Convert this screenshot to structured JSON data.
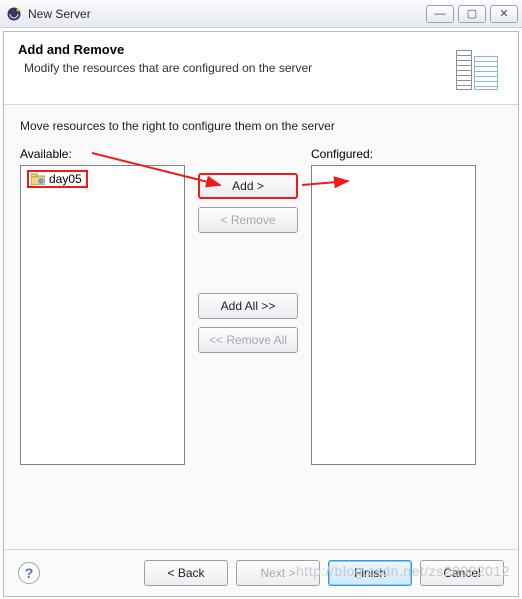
{
  "window": {
    "title": "New Server",
    "minimize_glyph": "—",
    "maximize_glyph": "▢",
    "close_glyph": "✕"
  },
  "banner": {
    "title": "Add and Remove",
    "subtitle": "Modify the resources that are configured on the server"
  },
  "body": {
    "instruction": "Move resources to the right to configure them on the server",
    "available_label": "Available:",
    "configured_label": "Configured:",
    "available_items": [
      {
        "label": "day05"
      }
    ]
  },
  "buttons": {
    "add": "Add >",
    "remove": "< Remove",
    "add_all": "Add All >>",
    "remove_all": "<< Remove All"
  },
  "footer": {
    "help_glyph": "?",
    "back": "< Back",
    "next": "Next >",
    "finish": "Finish",
    "cancel": "Cancel"
  },
  "watermark": "http://blog.csdn.net/zs20082012"
}
